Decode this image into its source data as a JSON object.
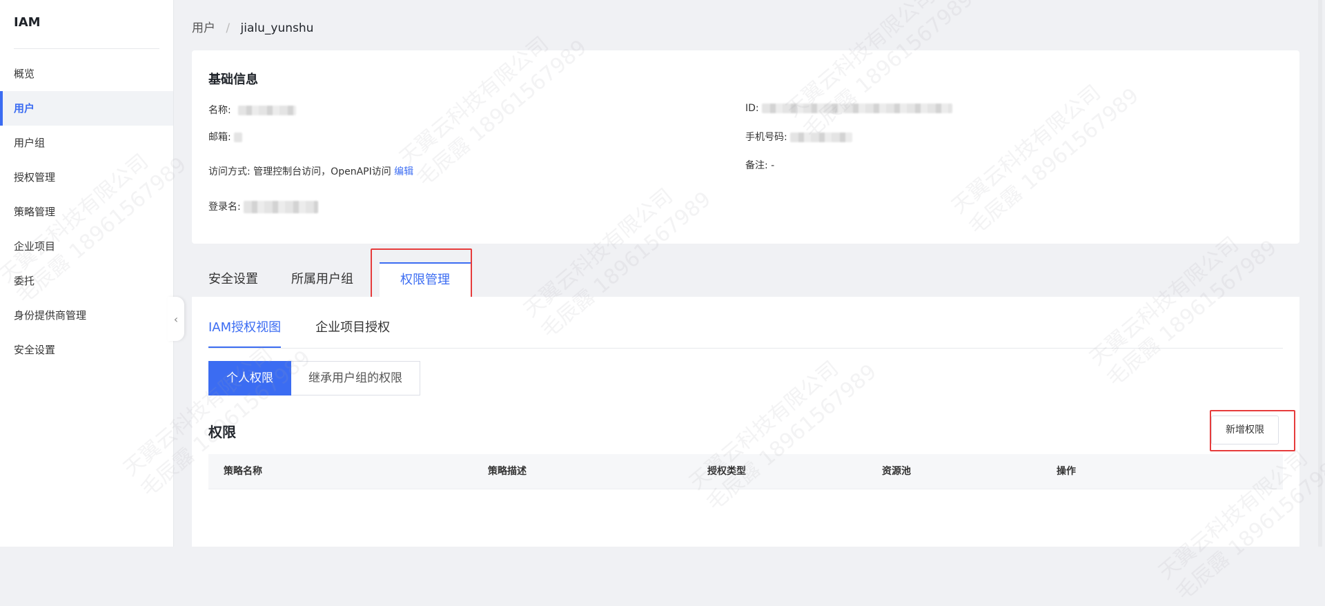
{
  "sidebar": {
    "title": "IAM",
    "items": [
      {
        "label": "概览"
      },
      {
        "label": "用户"
      },
      {
        "label": "用户组"
      },
      {
        "label": "授权管理"
      },
      {
        "label": "策略管理"
      },
      {
        "label": "企业项目"
      },
      {
        "label": "委托"
      },
      {
        "label": "身份提供商管理"
      },
      {
        "label": "安全设置"
      }
    ],
    "active_index": 1
  },
  "breadcrumb": {
    "parent": "用户",
    "separator": "/",
    "current": "jialu_yunshu"
  },
  "basic_info": {
    "title": "基础信息",
    "name_label": "名称:",
    "email_label": "邮箱:",
    "access_label": "访问方式:",
    "access_value": "管理控制台访问，OpenAPI访问",
    "edit_link": "编辑",
    "login_label": "登录名:",
    "id_label": "ID:",
    "phone_label": "手机号码:",
    "remark_label": "备注:",
    "remark_value": "-"
  },
  "tabs": {
    "items": [
      "安全设置",
      "所属用户组",
      "权限管理"
    ],
    "active_index": 2
  },
  "subtabs": {
    "items": [
      "IAM授权视图",
      "企业项目授权"
    ],
    "active_index": 0
  },
  "segment": {
    "items": [
      "个人权限",
      "继承用户组的权限"
    ],
    "active_index": 0
  },
  "permissions": {
    "title": "权限",
    "add_button": "新增权限",
    "columns": [
      "策略名称",
      "策略描述",
      "授权类型",
      "资源池",
      "操作"
    ]
  },
  "watermark": {
    "line1": "天翼云科技有限公司",
    "line2": "毛辰露 18961567989"
  },
  "colors": {
    "accent": "#3b6cf2",
    "highlight": "#e63b3b",
    "background": "#f0f1f4"
  }
}
